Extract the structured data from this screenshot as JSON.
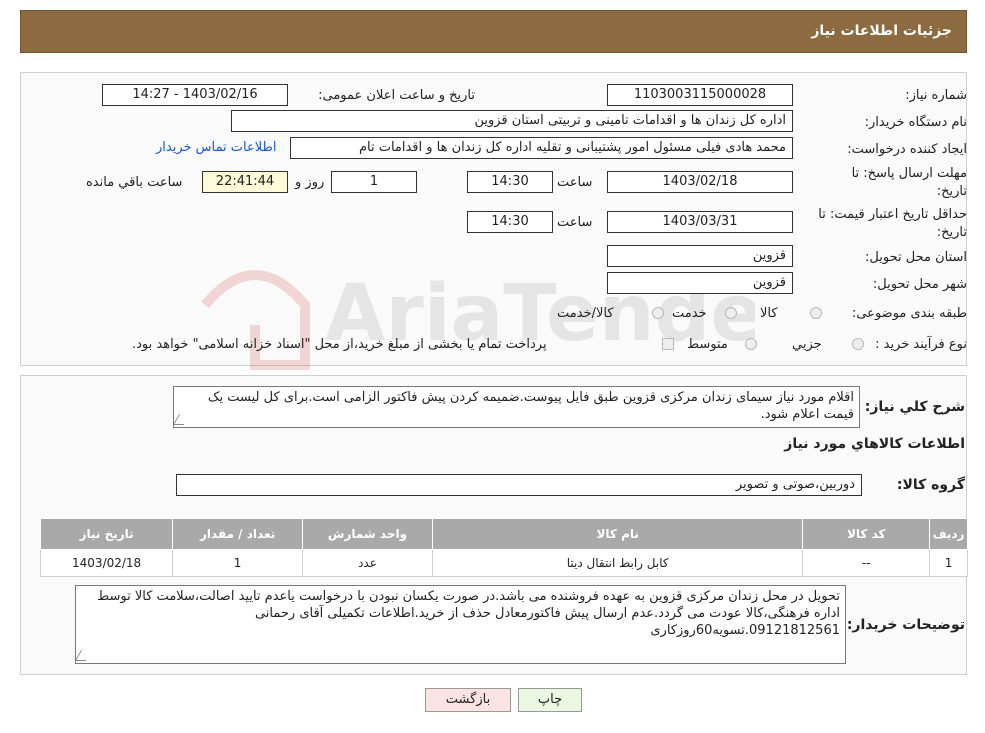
{
  "header": {
    "title": "جزئیات اطلاعات نیاز"
  },
  "form": {
    "need_number_label": "شماره نیاز:",
    "need_number": "1103003115000028",
    "announce_label": "تاریخ و ساعت اعلان عمومی:",
    "announce_value": "1403/02/16 - 14:27",
    "buyer_org_label": "نام دستگاه خریدار:",
    "buyer_org": "اداره کل زندان ها و اقدامات تامینی و تربیتی استان قزوین",
    "requester_label": "ایجاد کننده درخواست:",
    "requester": "محمد هادی فیلی مسئول امور پشتیبانی و تقلیه اداره کل زندان ها و اقدامات تام",
    "contact_link": "اطلاعات تماس خریدار",
    "reply_deadline_label_1": "مهلت ارسال پاسخ: تا",
    "reply_deadline_label_2": "تاریخ:",
    "reply_date": "1403/02/18",
    "time_label": "ساعت",
    "reply_time": "14:30",
    "days_value": "1",
    "days_label": "روز و",
    "remaining_time": "22:41:44",
    "remaining_label": "ساعت باقي مانده",
    "price_validity_label_1": "حداقل تاریخ اعتبار قیمت: تا",
    "price_validity_label_2": "تاریخ:",
    "price_date": "1403/03/31",
    "price_time": "14:30",
    "province_label": "استان محل تحویل:",
    "province": "قزوین",
    "city_label": "شهر محل تحویل:",
    "city": "قزوین",
    "category_label": "طبقه بندی موضوعی:",
    "category_options": [
      "کالا",
      "خدمت",
      "کالا/خدمت"
    ],
    "purchase_type_label": "نوع فرآیند خرید :",
    "purchase_options": [
      "جزیي",
      "متوسط"
    ],
    "purchase_note": "پرداخت تمام یا بخشی از مبلغ خرید،از محل \"اسناد خزانه اسلامی\" خواهد بود."
  },
  "description": {
    "label": "شرح کلي نياز:",
    "text": "اقلام مورد نیاز سیمای زندان مرکزی قزوین طبق فایل پیوست.ضمیمه کردن پیش فاکتور الزامی است.برای کل لیست یک قیمت اعلام شود."
  },
  "goods": {
    "section_title": "اطلاعات کالاهاي مورد نياز",
    "group_label": "گروه کالا:",
    "group_value": "دوربین،صوتی و تصویر",
    "table": {
      "headers": [
        "رديف",
        "کد کالا",
        "نام کالا",
        "واحد شمارش",
        "تعداد / مقدار",
        "تاريخ نياز"
      ],
      "rows": [
        [
          "1",
          "--",
          "کابل رابط انتقال دیتا",
          "عدد",
          "1",
          "1403/02/18"
        ]
      ]
    }
  },
  "buyer_notes": {
    "label": "توضیحات خریدار:",
    "text": "تحویل در محل زندان مرکزی قزوین به عهده فروشنده می باشد.در صورت یکسان نبودن با درخواست یاعدم تایید اصالت،سلامت کالا توسط اداره فرهنگی،کالا عودت می گردد.عدم ارسال پیش فاکتورمعادل حذف از خرید.اطلاعات تکمیلی آقای رحمانی 09121812561.تسویه60روزکاری"
  },
  "buttons": {
    "print": "چاپ",
    "back": "بازگشت"
  },
  "watermark": {
    "text": "AriaTender.neT"
  },
  "colors": {
    "header_bg": "#8b6b3f",
    "link": "#1a57c9",
    "back_button_bg": "#fbe3e3",
    "print_button_bg": "#eaf7e1"
  }
}
